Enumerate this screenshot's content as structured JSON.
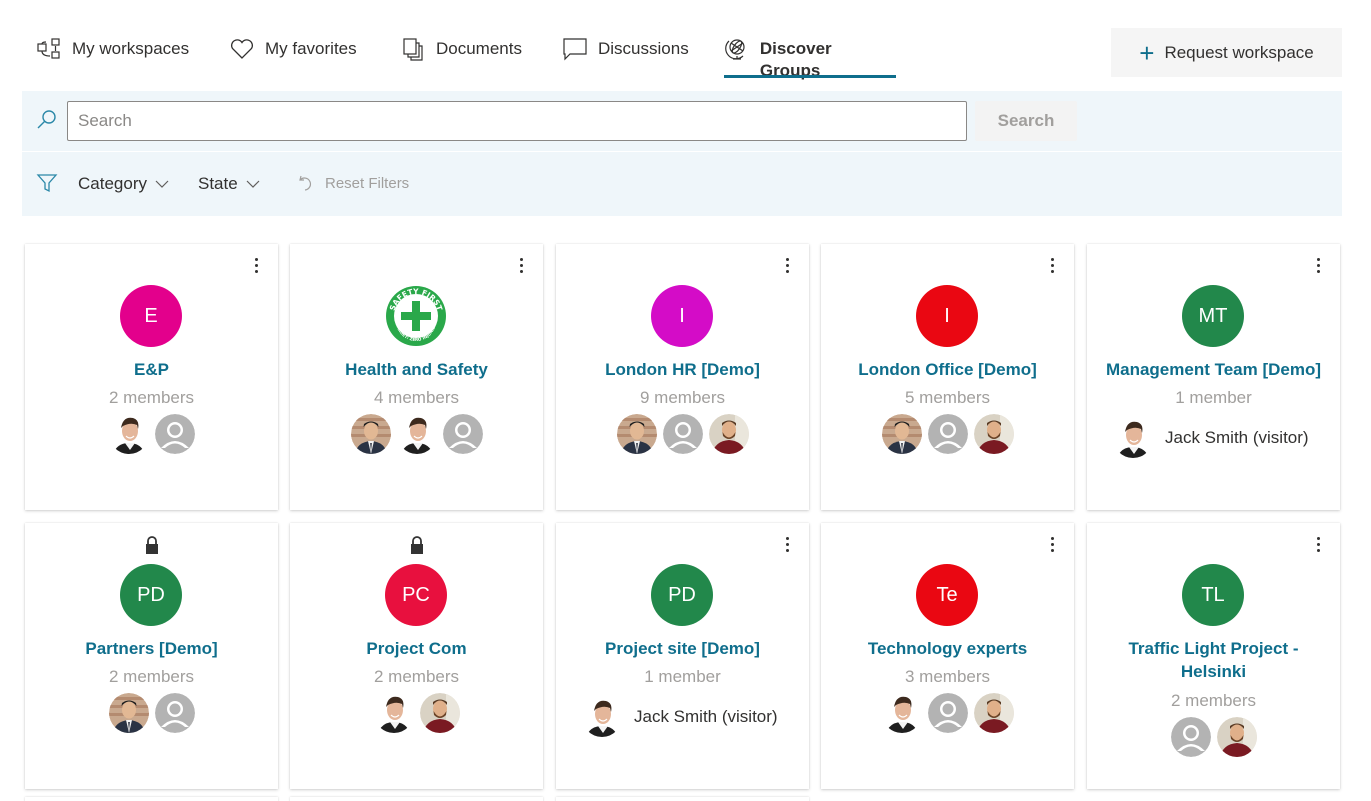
{
  "nav": {
    "items": [
      {
        "label": "My workspaces",
        "icon": "workspaces-icon",
        "active": false
      },
      {
        "label": "My favorites",
        "icon": "heart-icon",
        "active": false
      },
      {
        "label": "Documents",
        "icon": "documents-icon",
        "active": false
      },
      {
        "label": "Discussions",
        "icon": "chat-bubble-icon",
        "active": false
      },
      {
        "label": "Discover Groups",
        "icon": "globe-icon",
        "active": true
      }
    ],
    "request_button": {
      "label": "Request workspace",
      "icon": "plus-icon"
    }
  },
  "search": {
    "placeholder": "Search",
    "value": "",
    "button_label": "Search"
  },
  "filters": {
    "category_label": "Category",
    "state_label": "State",
    "reset_label": "Reset Filters"
  },
  "colors": {
    "accent": "#0f6e8c",
    "band_bg": "#eff6fa"
  },
  "groups": [
    {
      "title": "E&P",
      "initials": "E",
      "color": "#e3008c",
      "count": "2 members",
      "locked": false,
      "has_menu": true,
      "members": [
        "man-smiling",
        "default"
      ]
    },
    {
      "title": "Health and Safety",
      "initials": "",
      "logo": "safety-first",
      "color": "#ffffff",
      "count": "4 members",
      "locked": false,
      "has_menu": true,
      "members": [
        "man-asian",
        "man-smiling",
        "default"
      ]
    },
    {
      "title": "London HR [Demo]",
      "initials": "I",
      "color": "#d40cc7",
      "count": "9 members",
      "locked": false,
      "has_menu": true,
      "members": [
        "man-asian",
        "default",
        "man-bearded"
      ]
    },
    {
      "title": "London Office [Demo]",
      "initials": "I",
      "color": "#ea0712",
      "count": "5 members",
      "locked": false,
      "has_menu": true,
      "members": [
        "man-asian",
        "default",
        "man-bearded"
      ]
    },
    {
      "title": "Management Team [Demo]",
      "initials": "MT",
      "color": "#22884b",
      "count": "1 member",
      "locked": false,
      "has_menu": true,
      "visitor": "Jack Smith (visitor)"
    },
    {
      "title": "Partners [Demo]",
      "initials": "PD",
      "color": "#22884b",
      "count": "2 members",
      "locked": true,
      "has_menu": false,
      "members": [
        "man-asian",
        "default"
      ]
    },
    {
      "title": "Project Com",
      "initials": "PC",
      "color": "#e8103e",
      "count": "2 members",
      "locked": true,
      "has_menu": false,
      "members": [
        "man-smiling",
        "man-bearded"
      ]
    },
    {
      "title": "Project site [Demo]",
      "initials": "PD",
      "color": "#22884b",
      "count": "1 member",
      "locked": false,
      "has_menu": true,
      "visitor": "Jack Smith (visitor)"
    },
    {
      "title": "Technology experts",
      "initials": "Te",
      "color": "#ea0712",
      "count": "3 members",
      "locked": false,
      "has_menu": true,
      "members": [
        "man-smiling",
        "default",
        "man-bearded"
      ]
    },
    {
      "title": "Traffic Light Project - Helsinki",
      "initials": "TL",
      "color": "#22884b",
      "count": "2 members",
      "locked": false,
      "has_menu": true,
      "members": [
        "default",
        "man-bearded"
      ]
    }
  ],
  "safety_logo": {
    "top_text": "SAFETY FIRST",
    "bottom_text": "TARGET: ZERO INJURIES"
  }
}
